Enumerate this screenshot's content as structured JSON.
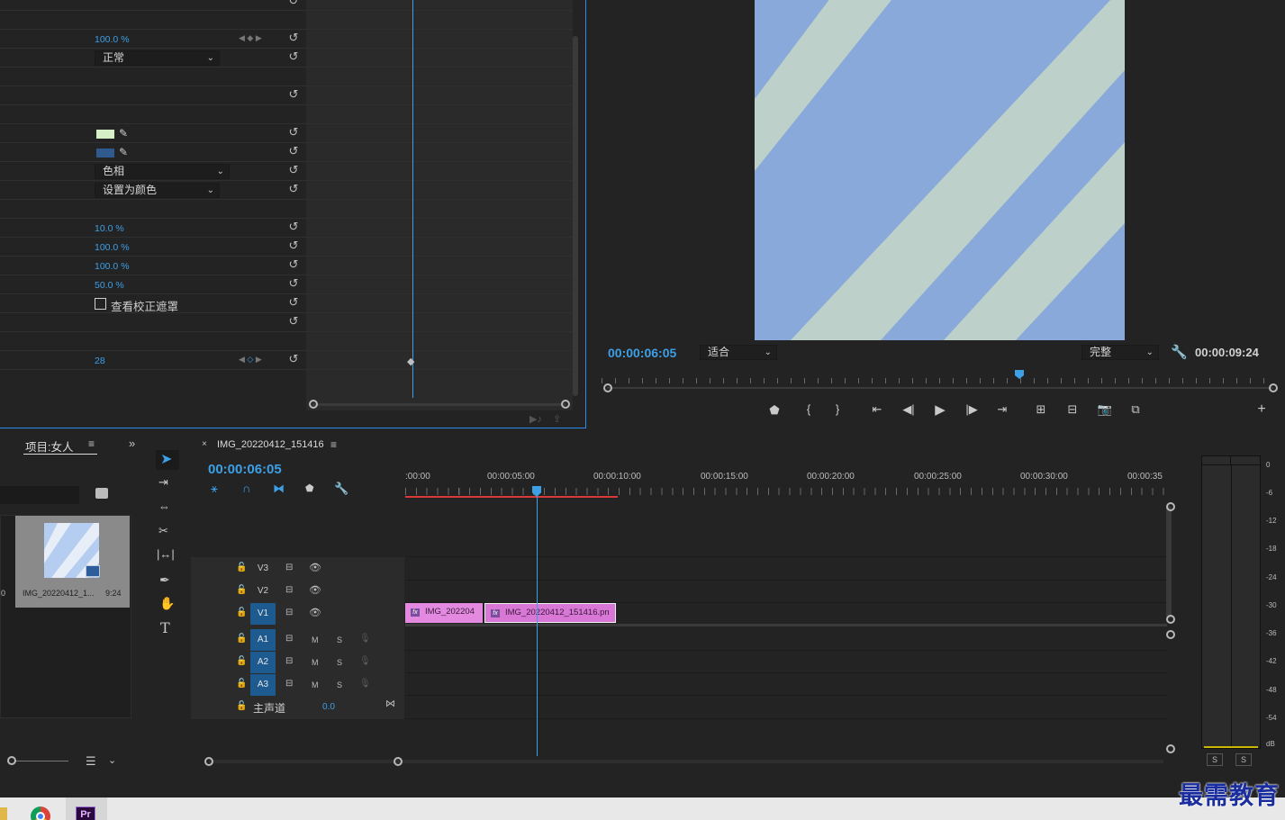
{
  "effects": {
    "values": {
      "opacity": "100.0 %",
      "blend_mode": "正常",
      "hue_mode": "色相",
      "set_color": "设置为颜色",
      "v1": "10.0 %",
      "v2": "100.0 %",
      "v3": "100.0 %",
      "v4": "50.0 %",
      "view_mask_label": "查看校正遮罩",
      "frame_value": "28"
    },
    "colors": {
      "swatch1": "#d5efc7",
      "swatch2": "#2e5a8e"
    }
  },
  "program": {
    "current_time": "00:00:06:05",
    "zoom": "适合",
    "quality": "完整",
    "duration": "00:00:09:24",
    "playhead_fraction": 0.62
  },
  "project": {
    "title": "项目:女人",
    "clip_name": "IMG_20220412_1...",
    "clip_duration": "9:24",
    "left_label": "0"
  },
  "timeline": {
    "sequence_name": "IMG_20220412_151416",
    "current_time": "00:00:06:05",
    "ruler": [
      ":00:00",
      "00:00:05:00",
      "00:00:10:00",
      "00:00:15:00",
      "00:00:20:00",
      "00:00:25:00",
      "00:00:30:00",
      "00:00:35"
    ],
    "tracks_video": [
      "V3",
      "V2",
      "V1"
    ],
    "tracks_audio": [
      "A1",
      "A2",
      "A3"
    ],
    "master_label": "主声道",
    "master_value": "0.0",
    "clip1": "IMG_202204",
    "clip2": "IMG_20220412_151416.pn",
    "m_label": "M",
    "s_label": "S"
  },
  "meter": {
    "scale": [
      "0",
      "-6",
      "-12",
      "-18",
      "-24",
      "-30",
      "-36",
      "-42",
      "-48",
      "-54",
      "dB"
    ],
    "solo_l": "S",
    "solo_r": "S"
  },
  "watermark": "最需教育"
}
